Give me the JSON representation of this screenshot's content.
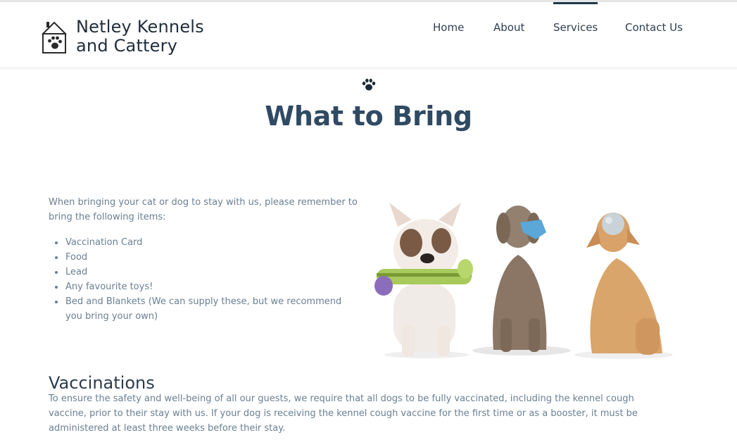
{
  "brand": {
    "name_line1": "Netley Kennels",
    "name_line2": "and Cattery",
    "icon": "house-paw-icon"
  },
  "nav": {
    "items": [
      {
        "label": "Home"
      },
      {
        "label": "About"
      },
      {
        "label": "Services",
        "active": true
      },
      {
        "label": "Contact Us"
      }
    ],
    "active_indicator_color": "#1f3a4a"
  },
  "page": {
    "divider_icon": "paw-icon",
    "title": "What to Bring"
  },
  "bring": {
    "intro": "When bringing your cat or dog to stay with us, please remember to bring the following items:",
    "items": [
      "Vaccination Card",
      "Food",
      "Lead",
      "Any favourite toys!",
      "Bed and Blankets (We can supply these, but we recommend you bring your own)"
    ],
    "image": "three-dogs-with-toys-photo"
  },
  "vaccinations": {
    "heading": "Vaccinations",
    "text": "To ensure the safety and well-being of all our guests, we require that all dogs to be fully vaccinated, including the kennel cough vaccine, prior to their stay with us. If your dog is receiving the kennel cough vaccine for the first time or as a booster, it must be administered at least three weeks before their stay."
  },
  "colors": {
    "title": "#2f4a63",
    "body_text": "#6a7f93",
    "nav_text": "#2d3e4f"
  }
}
